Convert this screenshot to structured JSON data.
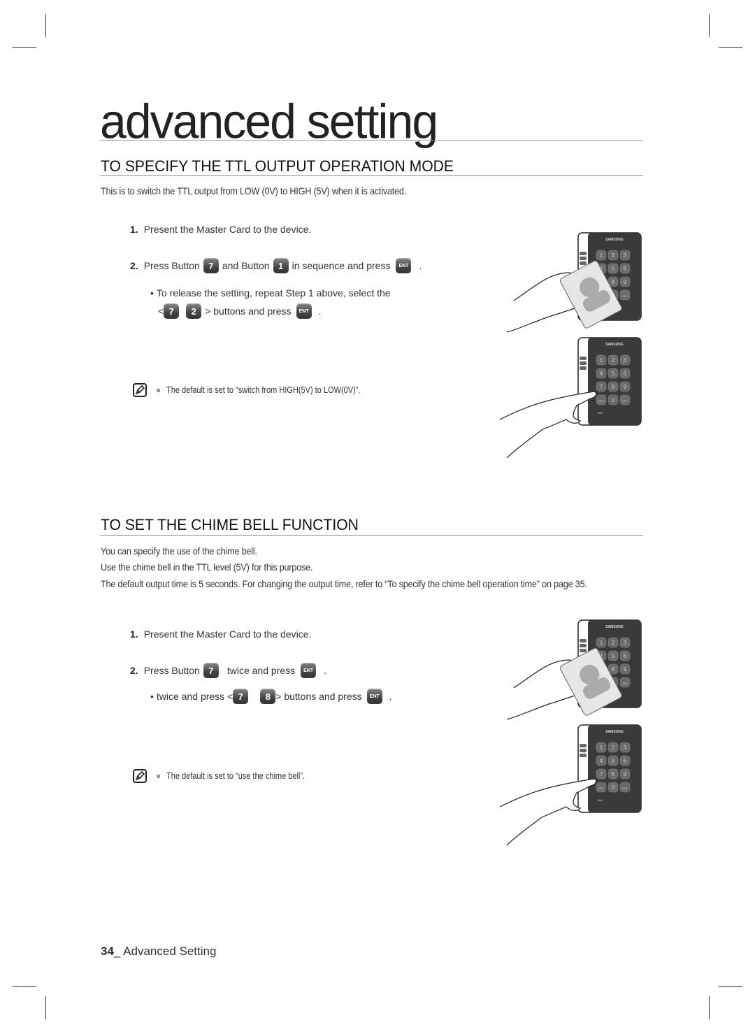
{
  "page": {
    "chapter_title": "advanced setting",
    "footer": {
      "page_number": "34",
      "separator": "_ ",
      "section": "Advanced Setting"
    }
  },
  "sections": [
    {
      "heading": "TO SPECIFY THE TTL OUTPUT OPERATION MODE",
      "intro": "This is to switch the TTL output from LOW (0V) to HIGH (5V) when it is activated.",
      "steps": [
        {
          "num": "1.",
          "text": "Present the Master Card to the device."
        },
        {
          "num": "2.",
          "parts": [
            "Press Button",
            "7",
            "and Button",
            "1",
            "in sequence and press",
            "ENT",
            "."
          ]
        }
      ],
      "bullet": {
        "line1": "To release the setting, repeat Step 1 above, select the",
        "line2_parts": [
          "<",
          "7",
          "2",
          "> buttons and press",
          "ENT",
          "."
        ]
      },
      "note": "The default is set to “switch from HIGH(5V) to LOW(0V)”."
    },
    {
      "heading": "TO SET THE CHIME BELL FUNCTION",
      "paragraphs": [
        "You can specify the use of the chime bell.",
        "Use the chime bell in the TTL level (5V) for this purpose.",
        "The default output time is 5 seconds. For changing the output time, refer to “To specify the chime bell operation time” on page 35."
      ],
      "steps": [
        {
          "num": "1.",
          "text": "Present the Master Card to the device."
        },
        {
          "num": "2.",
          "parts": [
            "Press Button",
            "7",
            "twice and press",
            "ENT",
            "."
          ]
        }
      ],
      "bullet": {
        "parts": [
          "twice and press <",
          "7",
          "8",
          "> buttons and press",
          "ENT",
          "."
        ]
      },
      "note": "The default is set to “use the chime bell”."
    }
  ],
  "device": {
    "brand": "SAMSUNG",
    "keys": [
      "1",
      "2",
      "3",
      "4",
      "5",
      "6",
      "7",
      "8",
      "9",
      "ESC",
      "0",
      "ENT"
    ],
    "bell_label": "Bell",
    "card_label": "Master Card"
  }
}
